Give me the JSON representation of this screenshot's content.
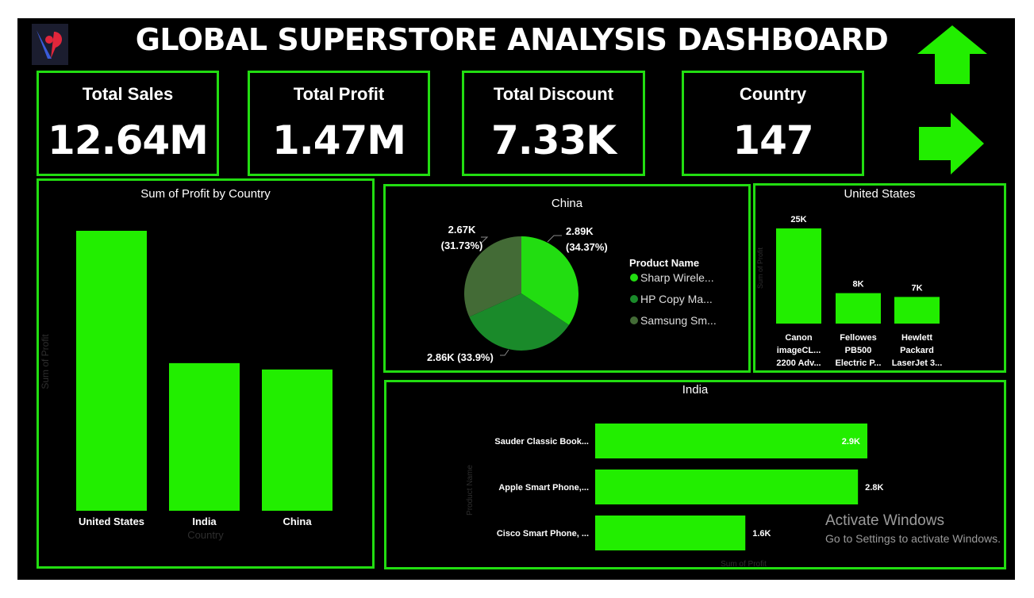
{
  "header": {
    "title": "GLOBAL SUPERSTORE ANALYSIS DASHBOARD"
  },
  "kpis": [
    {
      "label": "Total Sales",
      "value": "12.64M"
    },
    {
      "label": "Total Profit",
      "value": "1.47M"
    },
    {
      "label": "Total Discount",
      "value": "7.33K"
    },
    {
      "label": "Country",
      "value": "147"
    }
  ],
  "nav": {
    "up_icon": "arrow-up-icon",
    "right_icon": "arrow-right-icon"
  },
  "colors": {
    "accent": "#22ee00",
    "pie_1": "#22dd11",
    "pie_2": "#1a8a2a",
    "pie_3": "#436b36"
  },
  "chart_data": [
    {
      "type": "bar",
      "title": "Sum of Profit by Country",
      "xlabel": "Country",
      "ylabel": "Sum of Profit",
      "categories": [
        "United States",
        "India",
        "China"
      ],
      "values": [
        2.2,
        1.16,
        1.11
      ]
    },
    {
      "type": "pie",
      "title": "China",
      "legend_title": "Product Name",
      "legend": [
        "Sharp Wirele...",
        "HP Copy Ma...",
        "Samsung Sm..."
      ],
      "labels": [
        "2.89K\n(34.37%)",
        "2.86K (33.9%)",
        "2.67K\n(31.73%)"
      ],
      "values": [
        2.89,
        2.86,
        2.67
      ],
      "percents": [
        34.37,
        33.9,
        31.73
      ]
    },
    {
      "type": "bar",
      "title": "United States",
      "ylabel": "Sum of Profit",
      "categories": [
        "Canon imageCL... 2200 Adv...",
        "Fellowes PB500 Electric P...",
        "Hewlett Packard LaserJet 3..."
      ],
      "category_lines": [
        [
          "Canon",
          "imageCL...",
          "2200 Adv..."
        ],
        [
          "Fellowes",
          "PB500",
          "Electric P..."
        ],
        [
          "Hewlett",
          "Packard",
          "LaserJet 3..."
        ]
      ],
      "values": [
        25,
        8,
        7
      ],
      "data_labels": [
        "25K",
        "8K",
        "7K"
      ]
    },
    {
      "type": "bar",
      "orientation": "horizontal",
      "title": "India",
      "xlabel": "Sum of Profit",
      "ylabel": "Product Name",
      "categories": [
        "Sauder Classic Book...",
        "Apple Smart Phone,...",
        "Cisco Smart Phone, ..."
      ],
      "values": [
        2.9,
        2.8,
        1.6
      ],
      "data_labels": [
        "2.9K",
        "2.8K",
        "1.6K"
      ]
    }
  ],
  "watermark": {
    "line1": "Activate Windows",
    "line2": "Go to Settings to activate Windows."
  }
}
